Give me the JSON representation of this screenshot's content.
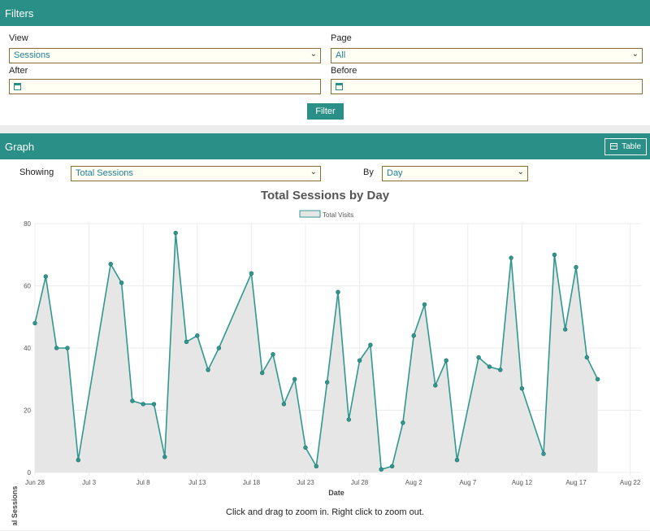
{
  "filters": {
    "title": "Filters",
    "view_label": "View",
    "view_value": "Sessions",
    "page_label": "Page",
    "page_value": "All",
    "after_label": "After",
    "after_value": "",
    "before_label": "Before",
    "before_value": "",
    "filter_button": "Filter"
  },
  "graph": {
    "title": "Graph",
    "table_button": "Table",
    "showing_label": "Showing",
    "showing_value": "Total Sessions",
    "by_label": "By",
    "by_value": "Day",
    "hint": "Click and drag to zoom in. Right click to zoom out."
  },
  "colors": {
    "accent": "#2a8f87",
    "line": "#2f9890",
    "fill": "#e6e6e6"
  },
  "chart_data": {
    "type": "area",
    "title": "Total Sessions by Day",
    "xlabel": "Date",
    "ylabel": "Total Sessions",
    "legend": [
      "Total Visits"
    ],
    "legend_position": "top",
    "grid": true,
    "ylim": [
      0,
      80
    ],
    "yticks": [
      "0",
      "20",
      "40",
      "60",
      "80"
    ],
    "xticks": [
      "Jun 28",
      "Jul 3",
      "Jul 8",
      "Jul 13",
      "Jul 18",
      "Jul 23",
      "Jul 28",
      "Aug 2",
      "Aug 7",
      "Aug 12",
      "Aug 17",
      "Aug 22"
    ],
    "x_start": "Jun 28",
    "series": [
      {
        "name": "Total Visits",
        "values": [
          48,
          63,
          40,
          40,
          4,
          null,
          null,
          67,
          61,
          23,
          22,
          22,
          5,
          77,
          42,
          44,
          33,
          40,
          null,
          null,
          64,
          32,
          38,
          22,
          30,
          8,
          2,
          29,
          58,
          17,
          36,
          41,
          1,
          2,
          16,
          44,
          54,
          28,
          36,
          4,
          null,
          37,
          34,
          33,
          69,
          27,
          null,
          6,
          70,
          46,
          66,
          37,
          30
        ]
      }
    ]
  }
}
